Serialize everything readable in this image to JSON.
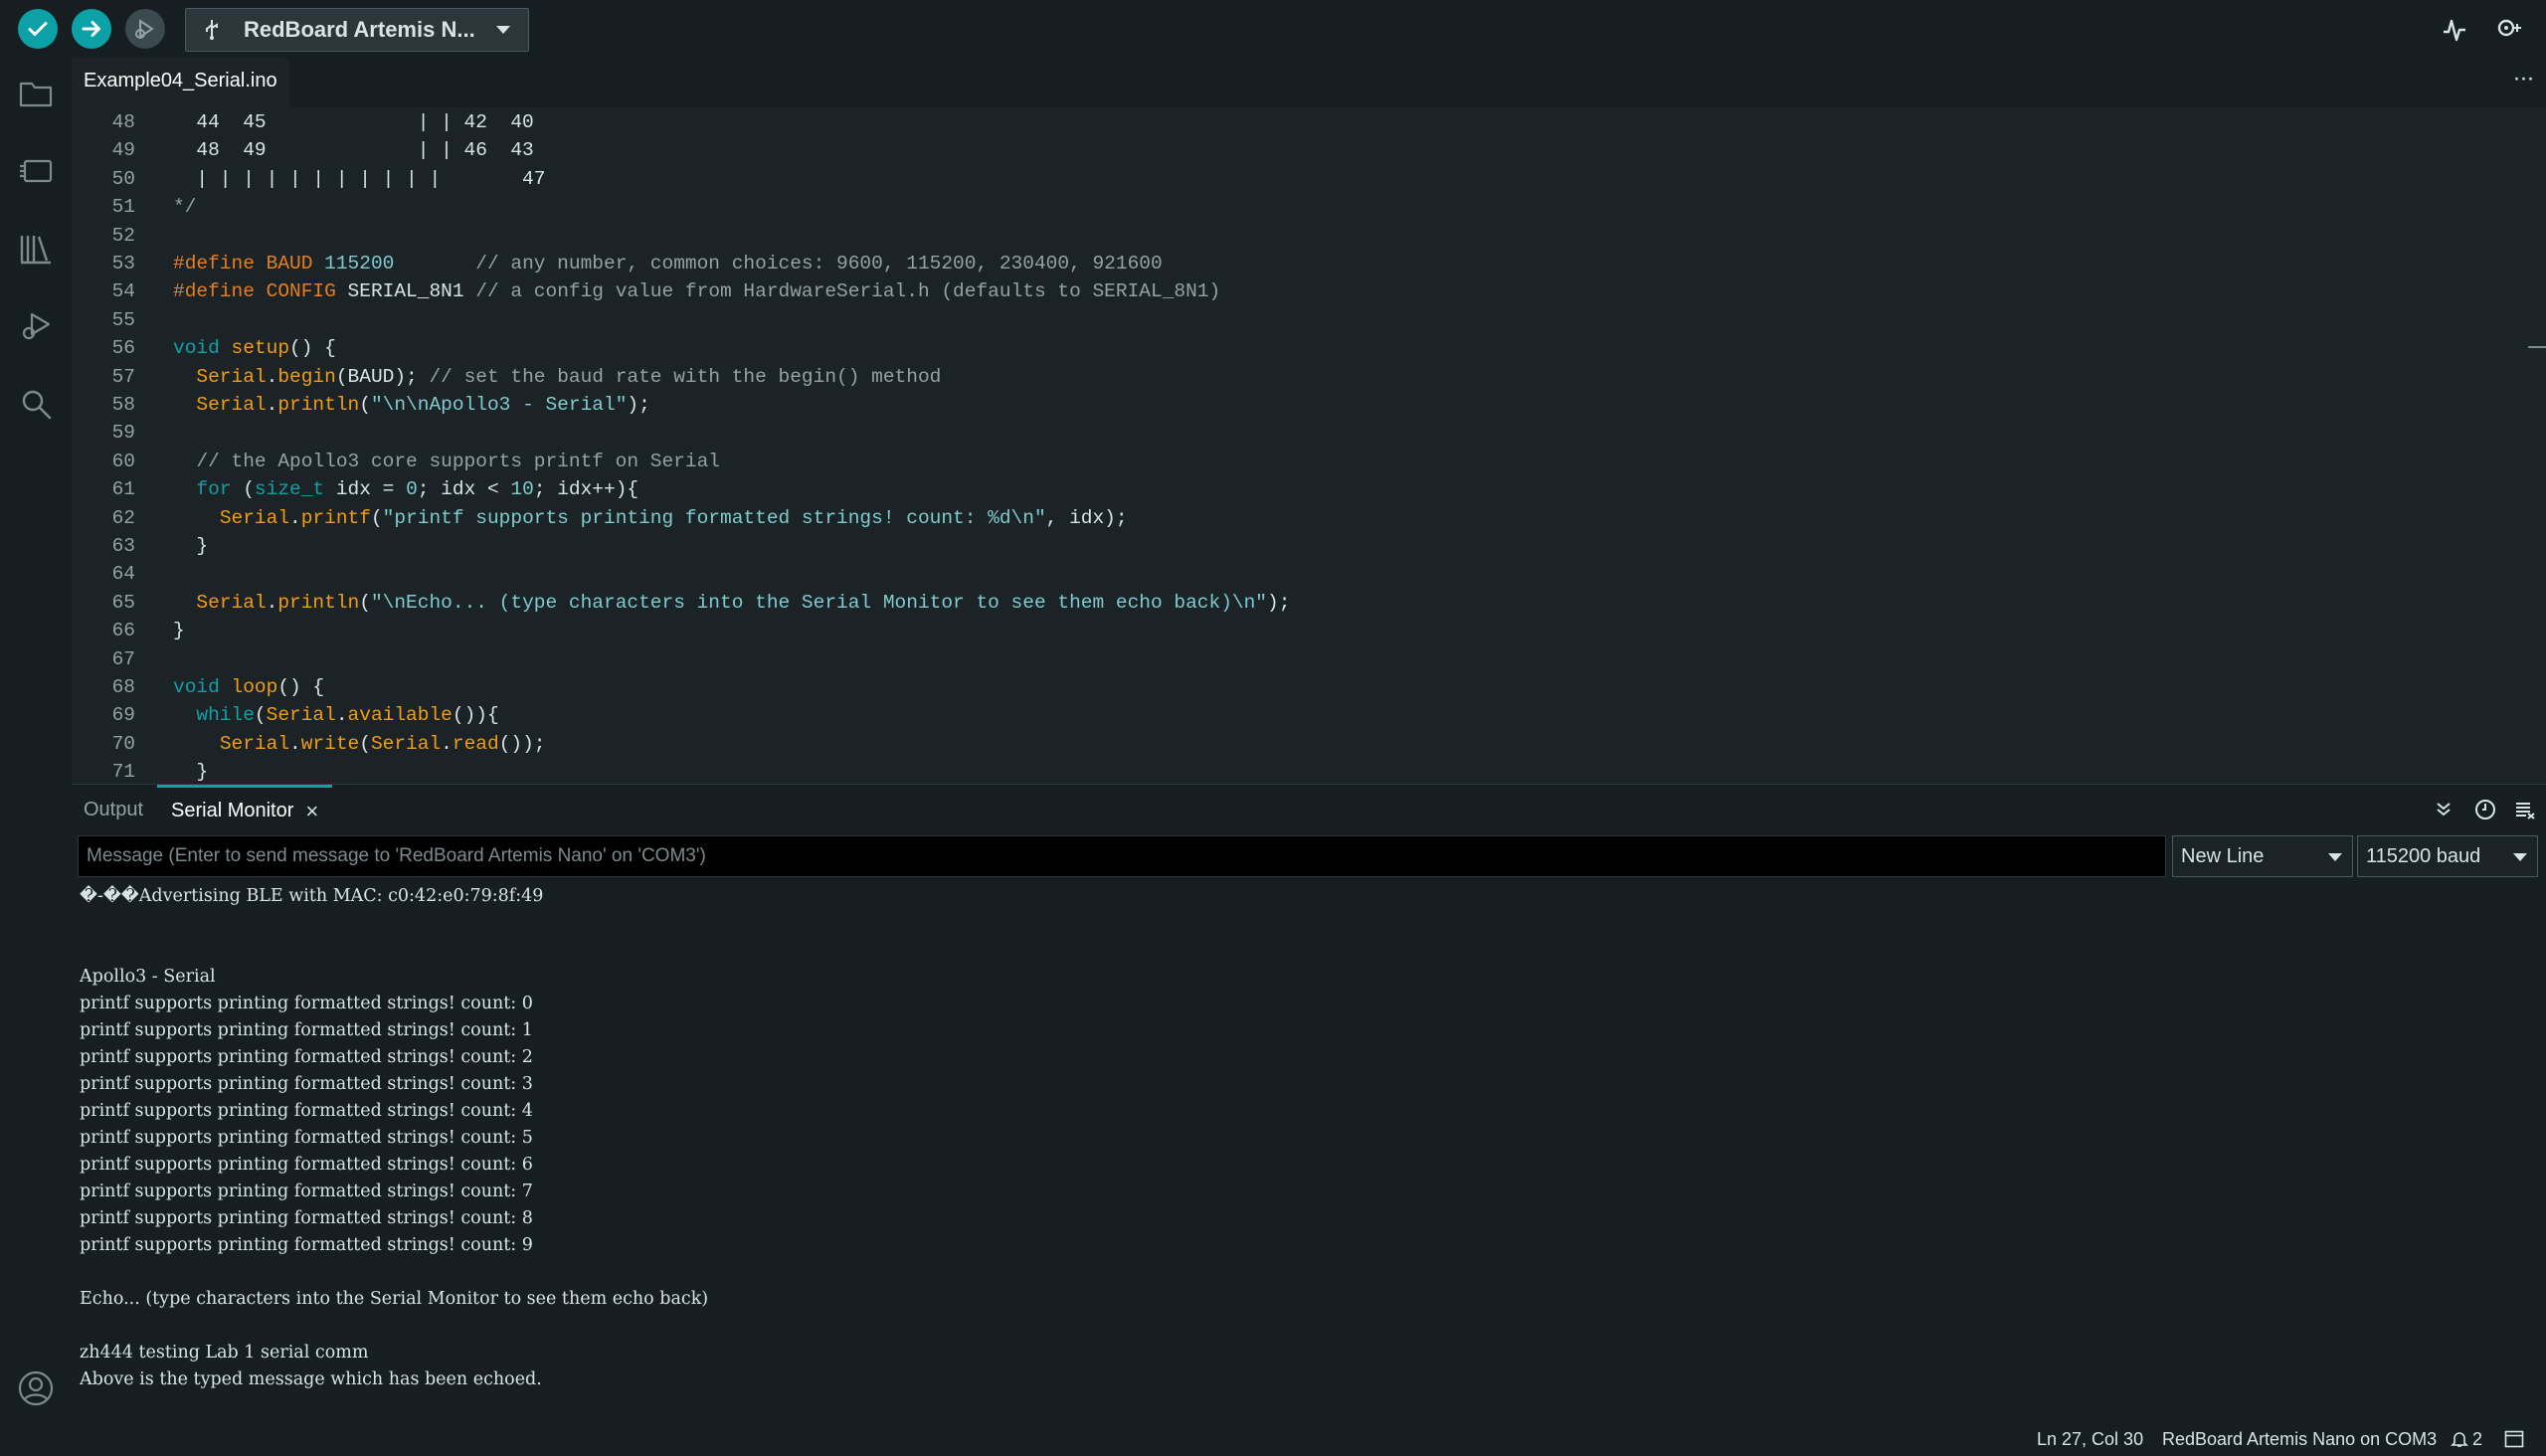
{
  "toolbar": {
    "verify_icon": "check-icon",
    "upload_icon": "arrow-right-icon",
    "debug_icon": "debug-icon",
    "board_label": "RedBoard Artemis N...",
    "serial_plotter_icon": "plotter-icon",
    "serial_monitor_icon": "serial-monitor-icon"
  },
  "sidebar": {
    "items": [
      {
        "name": "sketchbook",
        "icon": "folder-icon"
      },
      {
        "name": "boards-manager",
        "icon": "board-icon"
      },
      {
        "name": "library-manager",
        "icon": "library-icon"
      },
      {
        "name": "debug",
        "icon": "debug-icon"
      },
      {
        "name": "search",
        "icon": "search-icon"
      }
    ],
    "profile_icon": "account-icon"
  },
  "editor": {
    "tab_label": "Example04_Serial.ino",
    "more_label": "···",
    "lines": [
      {
        "n": "48",
        "segs": [
          {
            "t": "  44  45             | | 42  40",
            "c": ""
          }
        ]
      },
      {
        "n": "49",
        "segs": [
          {
            "t": "  48  49             | | 46  43",
            "c": ""
          }
        ]
      },
      {
        "n": "50",
        "segs": [
          {
            "t": "  | | | | | | | | | | |       47",
            "c": ""
          }
        ]
      },
      {
        "n": "51",
        "segs": [
          {
            "t": "*/",
            "c": "c-com"
          }
        ]
      },
      {
        "n": "52",
        "segs": []
      },
      {
        "n": "53",
        "segs": [
          {
            "t": "#define ",
            "c": "c-def"
          },
          {
            "t": "BAUD ",
            "c": "c-def"
          },
          {
            "t": "115200",
            "c": "c-num"
          },
          {
            "t": "       // any number, common choices: 9600, 115200, 230400, 921600",
            "c": "c-com"
          }
        ]
      },
      {
        "n": "54",
        "segs": [
          {
            "t": "#define ",
            "c": "c-def"
          },
          {
            "t": "CONFIG ",
            "c": "c-def"
          },
          {
            "t": "SERIAL_8N1",
            "c": ""
          },
          {
            "t": " // a config value from HardwareSerial.h (defaults to SERIAL_8N1)",
            "c": "c-com"
          }
        ]
      },
      {
        "n": "55",
        "segs": []
      },
      {
        "n": "56",
        "segs": [
          {
            "t": "void ",
            "c": "c-kw"
          },
          {
            "t": "setup",
            "c": "c-fn"
          },
          {
            "t": "() {",
            "c": ""
          }
        ]
      },
      {
        "n": "57",
        "segs": [
          {
            "t": "  ",
            "c": ""
          },
          {
            "t": "Serial",
            "c": "c-fn"
          },
          {
            "t": ".",
            "c": ""
          },
          {
            "t": "begin",
            "c": "c-fn"
          },
          {
            "t": "(BAUD); ",
            "c": ""
          },
          {
            "t": "// set the baud rate with the begin() method",
            "c": "c-com"
          }
        ]
      },
      {
        "n": "58",
        "segs": [
          {
            "t": "  ",
            "c": ""
          },
          {
            "t": "Serial",
            "c": "c-fn"
          },
          {
            "t": ".",
            "c": ""
          },
          {
            "t": "println",
            "c": "c-fn"
          },
          {
            "t": "(",
            "c": ""
          },
          {
            "t": "\"\\n\\nApollo3 - Serial\"",
            "c": "c-str"
          },
          {
            "t": ");",
            "c": ""
          }
        ]
      },
      {
        "n": "59",
        "segs": []
      },
      {
        "n": "60",
        "segs": [
          {
            "t": "  // the Apollo3 core supports printf on Serial",
            "c": "c-com"
          }
        ]
      },
      {
        "n": "61",
        "segs": [
          {
            "t": "  ",
            "c": ""
          },
          {
            "t": "for",
            "c": "c-kw"
          },
          {
            "t": " (",
            "c": ""
          },
          {
            "t": "size_t",
            "c": "c-kw"
          },
          {
            "t": " idx = ",
            "c": ""
          },
          {
            "t": "0",
            "c": "c-num"
          },
          {
            "t": "; idx < ",
            "c": ""
          },
          {
            "t": "10",
            "c": "c-num"
          },
          {
            "t": "; idx++){",
            "c": ""
          }
        ]
      },
      {
        "n": "62",
        "segs": [
          {
            "t": "    ",
            "c": ""
          },
          {
            "t": "Serial",
            "c": "c-fn"
          },
          {
            "t": ".",
            "c": ""
          },
          {
            "t": "printf",
            "c": "c-fn"
          },
          {
            "t": "(",
            "c": ""
          },
          {
            "t": "\"printf supports printing formatted strings! count: %d\\n\"",
            "c": "c-str"
          },
          {
            "t": ", idx);",
            "c": ""
          }
        ]
      },
      {
        "n": "63",
        "segs": [
          {
            "t": "  }",
            "c": ""
          }
        ]
      },
      {
        "n": "64",
        "segs": []
      },
      {
        "n": "65",
        "segs": [
          {
            "t": "  ",
            "c": ""
          },
          {
            "t": "Serial",
            "c": "c-fn"
          },
          {
            "t": ".",
            "c": ""
          },
          {
            "t": "println",
            "c": "c-fn"
          },
          {
            "t": "(",
            "c": ""
          },
          {
            "t": "\"\\nEcho... (type characters into the Serial Monitor to see them echo back)\\n\"",
            "c": "c-str"
          },
          {
            "t": ");",
            "c": ""
          }
        ]
      },
      {
        "n": "66",
        "segs": [
          {
            "t": "}",
            "c": ""
          }
        ]
      },
      {
        "n": "67",
        "segs": []
      },
      {
        "n": "68",
        "segs": [
          {
            "t": "void ",
            "c": "c-kw"
          },
          {
            "t": "loop",
            "c": "c-fn"
          },
          {
            "t": "() {",
            "c": ""
          }
        ]
      },
      {
        "n": "69",
        "segs": [
          {
            "t": "  ",
            "c": ""
          },
          {
            "t": "while",
            "c": "c-kw"
          },
          {
            "t": "(",
            "c": ""
          },
          {
            "t": "Serial",
            "c": "c-fn"
          },
          {
            "t": ".",
            "c": ""
          },
          {
            "t": "available",
            "c": "c-fn"
          },
          {
            "t": "()){",
            "c": ""
          }
        ]
      },
      {
        "n": "70",
        "segs": [
          {
            "t": "    ",
            "c": ""
          },
          {
            "t": "Serial",
            "c": "c-fn"
          },
          {
            "t": ".",
            "c": ""
          },
          {
            "t": "write",
            "c": "c-fn"
          },
          {
            "t": "(",
            "c": ""
          },
          {
            "t": "Serial",
            "c": "c-fn"
          },
          {
            "t": ".",
            "c": ""
          },
          {
            "t": "read",
            "c": "c-fn"
          },
          {
            "t": "());",
            "c": ""
          }
        ]
      },
      {
        "n": "71",
        "segs": [
          {
            "t": "  }",
            "c": ""
          }
        ]
      }
    ]
  },
  "panel": {
    "tab_output": "Output",
    "tab_serial": "Serial Monitor",
    "close_label": "×",
    "collapse_icon": "chevron-double-down-icon",
    "timestamp_icon": "clock-icon",
    "clear_icon": "clear-output-icon",
    "message_placeholder": "Message (Enter to send message to 'RedBoard Artemis Nano' on 'COM3')",
    "line_ending": "New Line",
    "baud": "115200 baud",
    "output_lines": [
      "�-��Advertising BLE with MAC: c0:42:e0:79:8f:49",
      "",
      "",
      "Apollo3 - Serial",
      "printf supports printing formatted strings! count: 0",
      "printf supports printing formatted strings! count: 1",
      "printf supports printing formatted strings! count: 2",
      "printf supports printing formatted strings! count: 3",
      "printf supports printing formatted strings! count: 4",
      "printf supports printing formatted strings! count: 5",
      "printf supports printing formatted strings! count: 6",
      "printf supports printing formatted strings! count: 7",
      "printf supports printing formatted strings! count: 8",
      "printf supports printing formatted strings! count: 9",
      "",
      "Echo... (type characters into the Serial Monitor to see them echo back)",
      "",
      "zh444 testing Lab 1 serial comm",
      "Above is the typed message which has been echoed."
    ]
  },
  "status": {
    "cursor": "Ln 27, Col 30",
    "board_port": "RedBoard Artemis Nano on COM3",
    "notifications": "2",
    "notification_icon": "bell-icon",
    "layout_icon": "panel-layout-icon"
  },
  "colors": {
    "accent": "#0ca1a6",
    "background": "#171e21",
    "editor_background": "#1b2327"
  }
}
